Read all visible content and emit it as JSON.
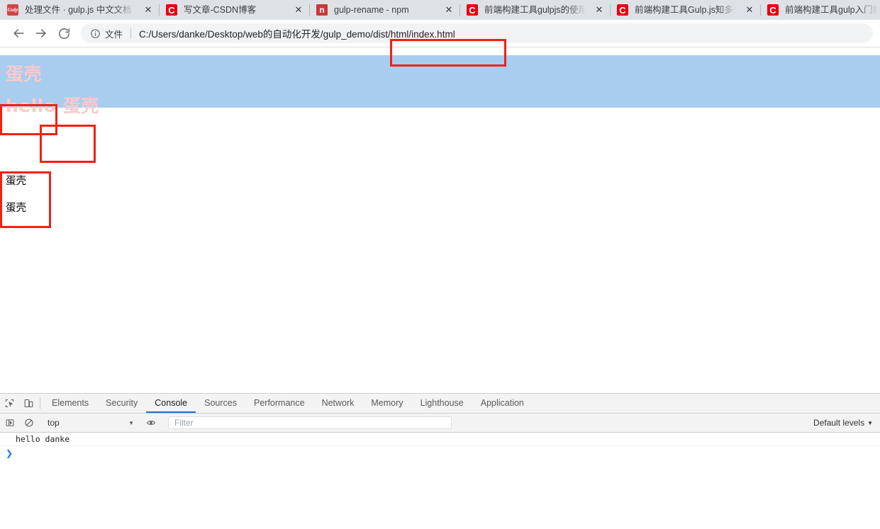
{
  "browser": {
    "tabs": [
      {
        "title": "处理文件 · gulp.js 中文文档",
        "favicon": "gulp-favicon",
        "favicon_text": "Gulp",
        "close": "✕"
      },
      {
        "title": "写文章-CSDN博客",
        "favicon": "csdn-favicon",
        "favicon_text": "C",
        "close": "✕"
      },
      {
        "title": "gulp-rename - npm",
        "favicon": "npm-favicon",
        "favicon_text": "n",
        "close": "✕"
      },
      {
        "title": "前端构建工具gulpjs的使用",
        "favicon": "csdn-favicon",
        "favicon_text": "C",
        "close": "✕"
      },
      {
        "title": "前端构建工具Gulp.js知多少",
        "favicon": "csdn-favicon",
        "favicon_text": "C",
        "close": "✕"
      },
      {
        "title": "前端构建工具gulp入门教程",
        "favicon": "csdn-favicon",
        "favicon_text": "C",
        "close": "✕"
      }
    ],
    "toolbar": {
      "back_label": "back-arrow",
      "forward_label": "forward-arrow",
      "reload_label": "reload",
      "info_icon": "info-circle-icon",
      "scheme_label": "文件",
      "url": "C:/Users/danke/Desktop/web的自动化开发/gulp_demo/dist/html/index.html"
    }
  },
  "page": {
    "banner": {
      "line1": "蛋壳",
      "line2": "hello 蛋壳"
    },
    "body": {
      "item1": "蛋壳",
      "item2": "蛋壳"
    },
    "annotations": {
      "box_url": "/dist/html/index.html",
      "box_a": "蛋壳",
      "box_b": "蛋壳",
      "box_c": "蛋壳 蛋壳"
    },
    "colors": {
      "banner_bg": "#a8cdee",
      "banner_text": "#fbc9cd",
      "annotation": "#f22113",
      "body_text": "#000000"
    }
  },
  "devtools": {
    "tabs": [
      {
        "label": "Elements",
        "active": false
      },
      {
        "label": "Security",
        "active": false
      },
      {
        "label": "Console",
        "active": true
      },
      {
        "label": "Sources",
        "active": false
      },
      {
        "label": "Performance",
        "active": false
      },
      {
        "label": "Network",
        "active": false
      },
      {
        "label": "Memory",
        "active": false
      },
      {
        "label": "Lighthouse",
        "active": false
      },
      {
        "label": "Application",
        "active": false
      }
    ],
    "icons": {
      "inspect": "inspect-element-icon",
      "device": "device-toolbar-icon",
      "sidebar": "console-sidebar-icon",
      "clear": "clear-console-icon",
      "eye": "live-expression-icon"
    },
    "filterbar": {
      "context": "top",
      "context_caret": "▼",
      "filter_placeholder": "Filter",
      "levels": "Default levels",
      "levels_caret": "▼"
    },
    "console": {
      "messages": [
        {
          "text": "hello danke"
        }
      ],
      "prompt": "❯"
    }
  }
}
